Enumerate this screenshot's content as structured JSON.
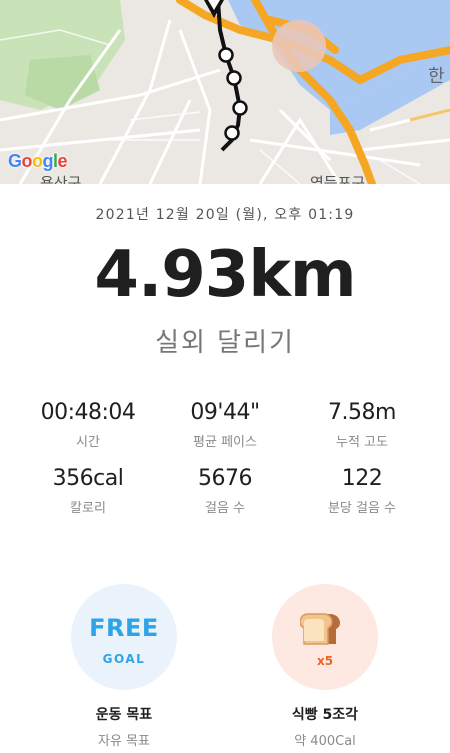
{
  "map": {
    "logo_text": "Google"
  },
  "record": {
    "date": "2021년 12월 20일 (월), 오후 01:19",
    "distance": "4.93km",
    "activity": "실외 달리기"
  },
  "stats": [
    {
      "value": "00:48:04",
      "label": "시간"
    },
    {
      "value": "09'44\"",
      "label": "평균 페이스"
    },
    {
      "value": "7.58m",
      "label": "누적 고도"
    },
    {
      "value": "356cal",
      "label": "칼로리"
    },
    {
      "value": "5676",
      "label": "걸음 수"
    },
    {
      "value": "122",
      "label": "분당 걸음 수"
    }
  ],
  "goals": {
    "free": {
      "main": "FREE",
      "sub": "GOAL",
      "title": "운동 목표",
      "caption": "자유 목표"
    },
    "bread": {
      "multiplier": "x5",
      "title": "식빵 5조각",
      "caption": "약 400Cal"
    }
  },
  "colors": {
    "accent_blue": "#2ea3e6",
    "accent_orange": "#e8652a",
    "route": "#111111",
    "road": "#f5a623"
  }
}
